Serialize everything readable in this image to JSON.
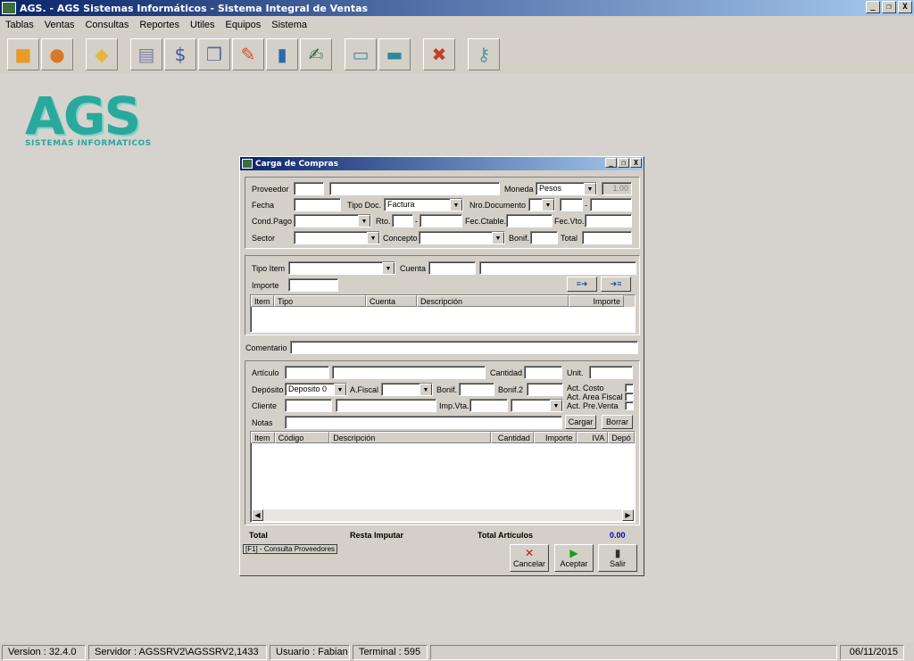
{
  "app": {
    "title": "AGS. - AGS Sistemas Informáticos - Sistema Integral de Ventas",
    "minimize": "_",
    "restore": "❐",
    "close": "X"
  },
  "menu": [
    "Tablas",
    "Ventas",
    "Consultas",
    "Reportes",
    "Utiles",
    "Equipos",
    "Sistema"
  ],
  "toolbar_icons": [
    "box-add-icon",
    "users-icon",
    "package-icon",
    "cash-register-icon",
    "price-tag-icon",
    "windows-icon",
    "pencil-icon",
    "book-icon",
    "edit-document-icon",
    "folder-transfer-icon",
    "truck-icon",
    "tools-icon",
    "key-icon"
  ],
  "logo": {
    "text": "AGS",
    "subtitle": "SISTEMAS INFORMATICOS"
  },
  "dialog": {
    "title": "Carga de Compras",
    "header": {
      "proveedor_label": "Proveedor",
      "moneda_label": "Moneda",
      "moneda_value": "Pesos",
      "cotizacion_value": "1.00",
      "fecha_label": "Fecha",
      "tipo_doc_label": "Tipo Doc.",
      "tipo_doc_value": "Factura",
      "nro_documento_label": "Nro.Documento",
      "nro_separator": "-",
      "cond_pago_label": "Cond.Pago",
      "rto_label": "Rto.",
      "rto_separator": "-",
      "fec_ctable_label": "Fec.Ctable.",
      "fec_vto_label": "Fec.Vto.",
      "sector_label": "Sector",
      "concepto_label": "Concepto",
      "bonif_label": "Bonif.",
      "total_label": "Total"
    },
    "items": {
      "tipo_item_label": "Tipo Item",
      "cuenta_label": "Cuenta",
      "importe_label": "Importe",
      "columns": [
        "Item",
        "Tipo",
        "Cuenta",
        "Descripción",
        "Importe"
      ]
    },
    "comentario_label": "Comentario",
    "articulos": {
      "articulo_label": "Artículo",
      "cantidad_label": "Cantidad",
      "unit_label": "Unit.",
      "deposito_label": "Depósito",
      "deposito_value": "Deposito 0",
      "afiscal_label": "A.Fiscal",
      "bonif_label": "Bonif.",
      "bonif2_label": "Bonif.2",
      "act_costo_label": "Act. Costo",
      "act_area_fiscal_label": "Act. Area Fiscal",
      "act_pre_venta_label": "Act. Pre.Venta",
      "cliente_label": "Cliente",
      "imp_vta_label": "Imp.Vta.",
      "notas_label": "Notas",
      "cargar_label": "Cargar",
      "borrar_label": "Borrar",
      "columns": [
        "Item",
        "Código",
        "Descripción",
        "Cantidad",
        "Importe",
        "IVA",
        "Depó"
      ]
    },
    "footer": {
      "total_label": "Total",
      "resta_imputar_label": "Resta Imputar",
      "total_articulos_label": "Total Artículos",
      "total_articulos_value": "0.00",
      "hint": "[F1] - Consulta Proveedores",
      "cancelar_label": "Cancelar",
      "aceptar_label": "Aceptar",
      "salir_label": "Salir"
    }
  },
  "status": {
    "version": "Version : 32.4.0",
    "servidor": "Servidor : AGSSRV2\\AGSSRV2,1433",
    "usuario": "Usuario : Fabian",
    "terminal": "Terminal : 595",
    "date": "06/11/2015"
  },
  "colors": {
    "accent": "#0a246a",
    "logo": "#2aa89c",
    "total_value": "#0000c0"
  }
}
